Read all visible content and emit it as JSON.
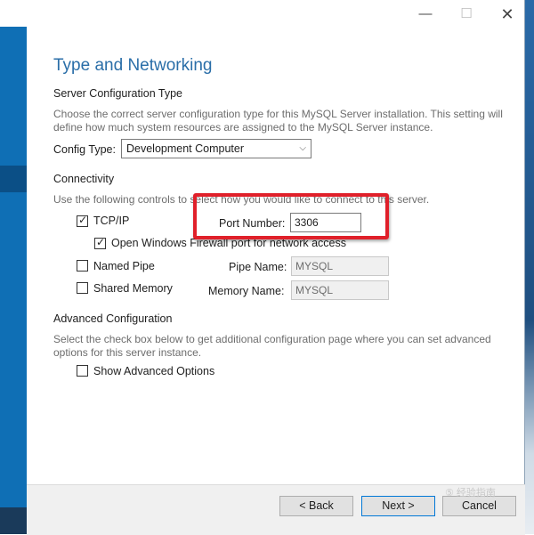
{
  "window": {
    "minimize_glyph": "—",
    "maximize_glyph": "☐",
    "close_glyph": "✕"
  },
  "page": {
    "title": "Type and Networking"
  },
  "server_config": {
    "section_title": "Server Configuration Type",
    "description": "Choose the correct server configuration type for this MySQL Server installation. This setting will define how much system resources are assigned to the MySQL Server instance.",
    "config_type_label": "Config Type:",
    "config_type_value": "Development Computer"
  },
  "connectivity": {
    "section_title": "Connectivity",
    "description": "Use the following controls to select how you would like to connect to this server.",
    "tcpip": {
      "label": "TCP/IP",
      "checked": true
    },
    "port_number_label": "Port Number:",
    "port_number_value": "3306",
    "firewall": {
      "label": "Open Windows Firewall port for network access",
      "checked": true
    },
    "named_pipe": {
      "label": "Named Pipe",
      "checked": false
    },
    "pipe_name_label": "Pipe Name:",
    "pipe_name_value": "MYSQL",
    "shared_memory": {
      "label": "Shared Memory",
      "checked": false
    },
    "memory_name_label": "Memory Name:",
    "memory_name_value": "MYSQL"
  },
  "advanced": {
    "section_title": "Advanced Configuration",
    "description": "Select the check box below to get additional configuration page where you can set advanced options for this server instance.",
    "show_advanced": {
      "label": "Show Advanced Options",
      "checked": false
    }
  },
  "footer": {
    "back_label": "< Back",
    "next_label": "Next >",
    "cancel_label": "Cancel",
    "watermark": "⑤ 经验指南"
  },
  "colors": {
    "title": "#2a6ea8",
    "highlight": "#e0202a",
    "sidebar": "#0f6fb5"
  },
  "icons": {
    "check": "✓",
    "chevron": "chevron-down-icon"
  }
}
